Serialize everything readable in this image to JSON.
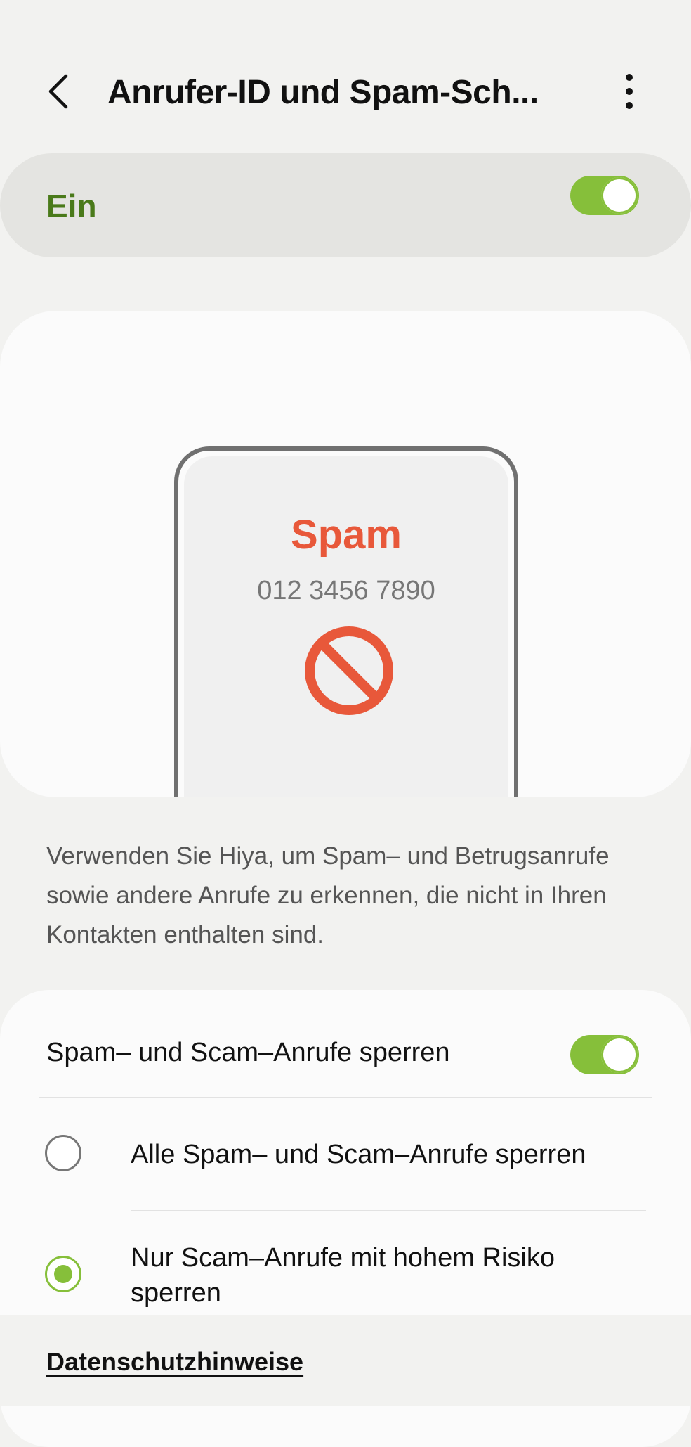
{
  "header": {
    "title": "Anrufer-ID und Spam-Sch...",
    "back_icon": "chevron-left-icon",
    "more_icon": "more-vertical-icon"
  },
  "master_switch": {
    "label": "Ein",
    "state": "on"
  },
  "illustration": {
    "caller_label": "Spam",
    "phone_number": "012 3456 7890",
    "icon": "block-icon"
  },
  "description": "Verwenden Sie Hiya, um Spam– und Betrugsanrufe sowie andere Anrufe zu erkennen, die nicht in Ihren Kontakten enthalten sind.",
  "settings": {
    "block_spam": {
      "label": "Spam– und Scam–Anrufe sperren",
      "state": "on"
    },
    "options": [
      {
        "label": "Alle Spam– und Scam–Anrufe sperren",
        "selected": false
      },
      {
        "label": "Nur Scam–Anrufe mit hohem Risiko sperren",
        "selected": true
      }
    ]
  },
  "footer": {
    "privacy_link": "Datenschutzhinweise"
  },
  "colors": {
    "accent": "#86bf3a",
    "master_label": "#4a7a1a",
    "spam": "#e8583a",
    "background": "#f2f2f0"
  }
}
